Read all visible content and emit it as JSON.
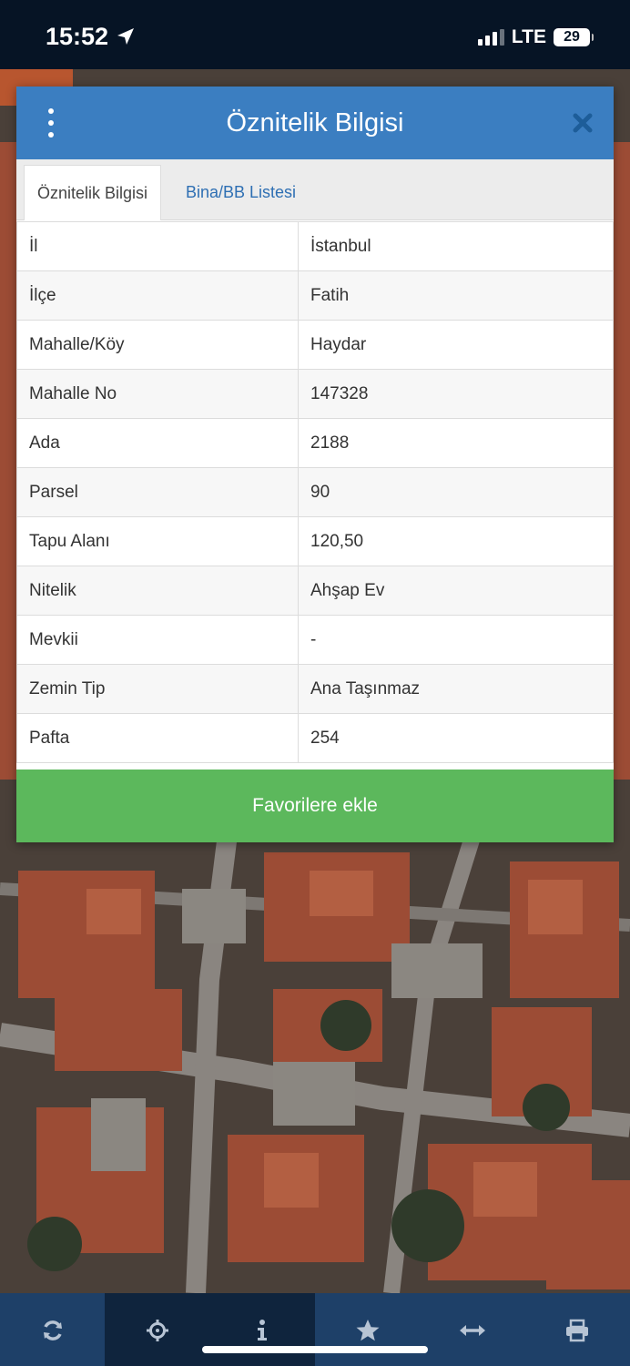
{
  "status_bar": {
    "time": "15:52",
    "network": "LTE",
    "battery": "29"
  },
  "dialog": {
    "title": "Öznitelik Bilgisi",
    "tabs": [
      {
        "label": "Öznitelik Bilgisi",
        "active": true
      },
      {
        "label": "Bina/BB Listesi",
        "active": false
      }
    ],
    "rows": [
      {
        "key": "İl",
        "value": "İstanbul"
      },
      {
        "key": "İlçe",
        "value": "Fatih"
      },
      {
        "key": "Mahalle/Köy",
        "value": "Haydar"
      },
      {
        "key": "Mahalle No",
        "value": "147328"
      },
      {
        "key": "Ada",
        "value": "2188"
      },
      {
        "key": "Parsel",
        "value": "90"
      },
      {
        "key": "Tapu Alanı",
        "value": "120,50"
      },
      {
        "key": "Nitelik",
        "value": "Ahşap Ev"
      },
      {
        "key": "Mevkii",
        "value": "-"
      },
      {
        "key": "Zemin Tip",
        "value": "Ana Taşınmaz"
      },
      {
        "key": "Pafta",
        "value": "254"
      }
    ],
    "favorite_label": "Favorilere ekle"
  },
  "toolbar": {
    "items": [
      {
        "icon": "refresh-icon"
      },
      {
        "icon": "crosshair-icon"
      },
      {
        "icon": "info-icon"
      },
      {
        "icon": "star-icon"
      },
      {
        "icon": "measure-icon"
      },
      {
        "icon": "print-icon"
      }
    ]
  },
  "colors": {
    "header_blue": "#3b7ec1",
    "tab_link": "#2e6fb3",
    "favorite_green": "#5cb85c",
    "status_bar": "#061425",
    "toolbar_dark": "#0f243d",
    "toolbar_light": "#1e4068"
  }
}
